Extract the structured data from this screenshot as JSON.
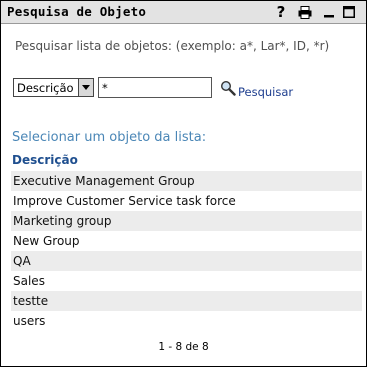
{
  "window": {
    "title": "Pesquisa de Objeto",
    "help_glyph": "?",
    "icons": [
      "help-icon",
      "print-icon",
      "minimize-icon",
      "maximize-icon"
    ]
  },
  "instructions": "Pesquisar lista de objetos: (exemplo: a*, Lar*, ID, *r)",
  "search": {
    "attribute_value": "Descrição",
    "query_value": "*",
    "button_label": "Pesquisar",
    "icon": "magnifier-icon"
  },
  "list": {
    "caption": "Selecionar um objeto da lista:",
    "column_header": "Descrição",
    "items": [
      "Executive Management Group",
      "Improve Customer Service task force",
      "Marketing group",
      "New Group",
      "QA",
      "Sales",
      "testte",
      "users"
    ]
  },
  "pagination": "1 - 8 de 8",
  "colors": {
    "title_bar": "#e3e3e3",
    "link": "#1f3f8f",
    "caption": "#4a86b6",
    "row_alt": "#ececec"
  }
}
